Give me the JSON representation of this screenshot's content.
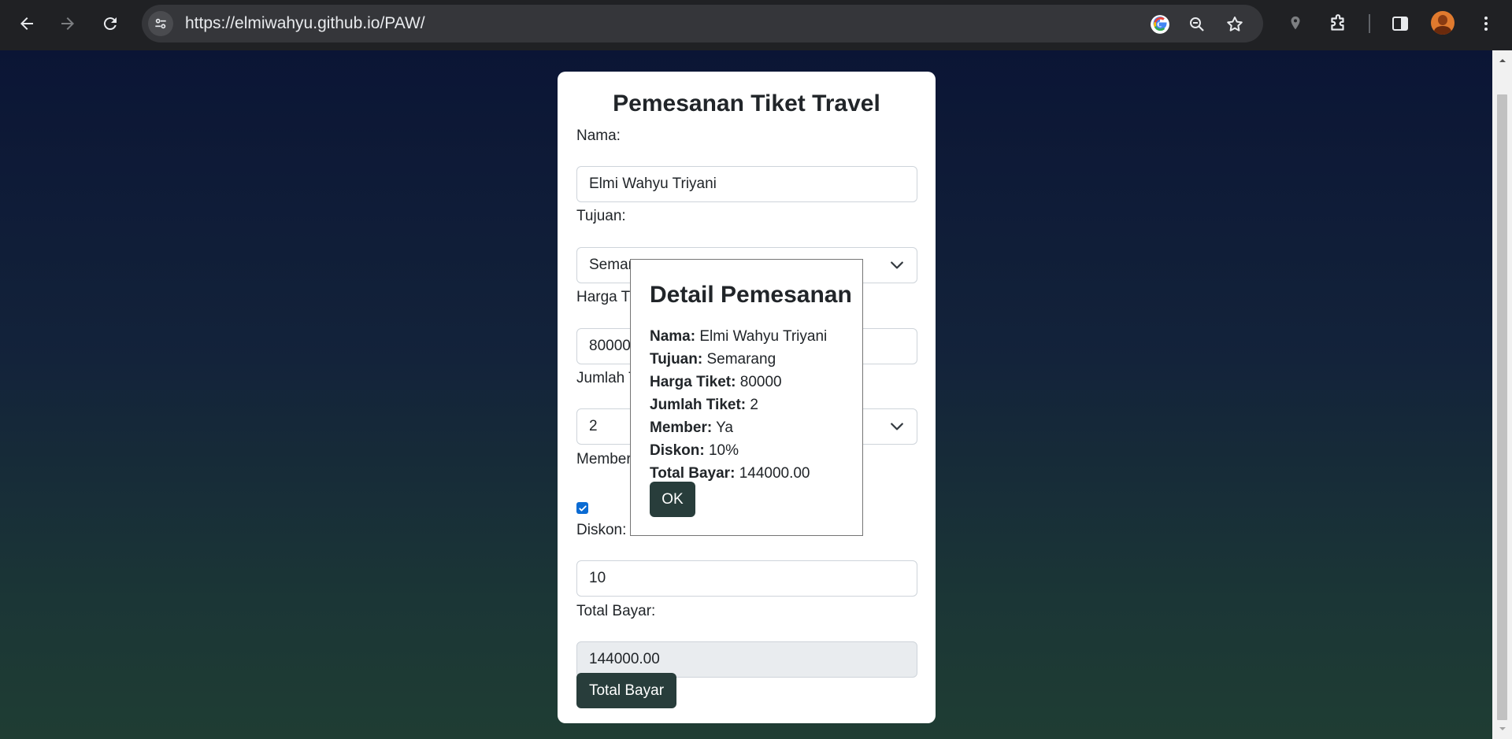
{
  "browser": {
    "url": "https://elmiwahyu.github.io/PAW/",
    "icons": [
      "back-icon",
      "forward-icon",
      "reload-icon",
      "site-info-icon",
      "google-icon",
      "zoom-icon",
      "bookmark-star-icon",
      "location-icon",
      "extensions-icon",
      "side-panel-icon",
      "profile-avatar",
      "menu-icon"
    ]
  },
  "form": {
    "title": "Pemesanan Tiket Travel",
    "nama_label": "Nama:",
    "nama_value": "Elmi Wahyu Triyani",
    "tujuan_label": "Tujuan:",
    "tujuan_value": "Semarang",
    "harga_label": "Harga Tiket:",
    "harga_value": "80000",
    "jumlah_label": "Jumlah Tiket:",
    "jumlah_value": "2",
    "member_label": "Member:",
    "member_checked": true,
    "diskon_label": "Diskon:",
    "diskon_value": "10",
    "total_label": "Total Bayar:",
    "total_value": "144000.00",
    "submit_label": "Total Bayar"
  },
  "modal": {
    "title": "Detail Pemesanan",
    "rows": [
      {
        "label": "Nama:",
        "value": "Elmi Wahyu Triyani"
      },
      {
        "label": "Tujuan:",
        "value": "Semarang"
      },
      {
        "label": "Harga Tiket:",
        "value": "80000"
      },
      {
        "label": "Jumlah Tiket:",
        "value": "2"
      },
      {
        "label": "Member:",
        "value": "Ya"
      },
      {
        "label": "Diskon:",
        "value": "10%"
      },
      {
        "label": "Total Bayar:",
        "value": "144000.00"
      }
    ],
    "ok_label": "OK"
  },
  "colors": {
    "chrome_bg": "#202124",
    "omnibox_bg": "#35363a",
    "button_dark": "#283d3b",
    "checkbox_blue": "#0b6bd3"
  }
}
